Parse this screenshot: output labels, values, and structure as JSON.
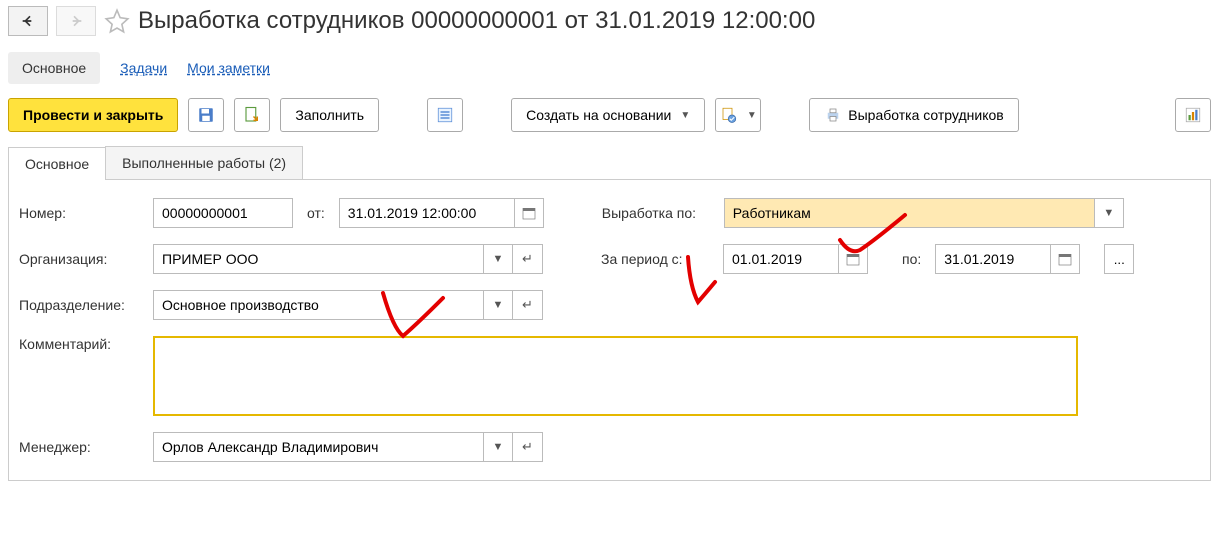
{
  "header": {
    "title": "Выработка сотрудников 00000000001 от 31.01.2019 12:00:00"
  },
  "nav": {
    "main": "Основное",
    "tasks": "Задачи",
    "notes": "Мои заметки"
  },
  "toolbar": {
    "post_close": "Провести и закрыть",
    "fill": "Заполнить",
    "create_based": "Создать на основании",
    "print_doc": "Выработка сотрудников"
  },
  "tabs": {
    "main": "Основное",
    "works": "Выполненные работы (2)"
  },
  "form": {
    "number_label": "Номер:",
    "number_value": "00000000001",
    "date_label": "от:",
    "date_value": "31.01.2019 12:00:00",
    "by_label": "Выработка по:",
    "by_value": "Работникам",
    "org_label": "Организация:",
    "org_value": "ПРИМЕР ООО",
    "period_from_label": "За период с:",
    "period_from_value": "01.01.2019",
    "period_to_label": "по:",
    "period_to_value": "31.01.2019",
    "dept_label": "Подразделение:",
    "dept_value": "Основное производство",
    "comment_label": "Комментарий:",
    "comment_value": "",
    "manager_label": "Менеджер:",
    "manager_value": "Орлов Александр Владимирович",
    "ellipsis": "..."
  }
}
